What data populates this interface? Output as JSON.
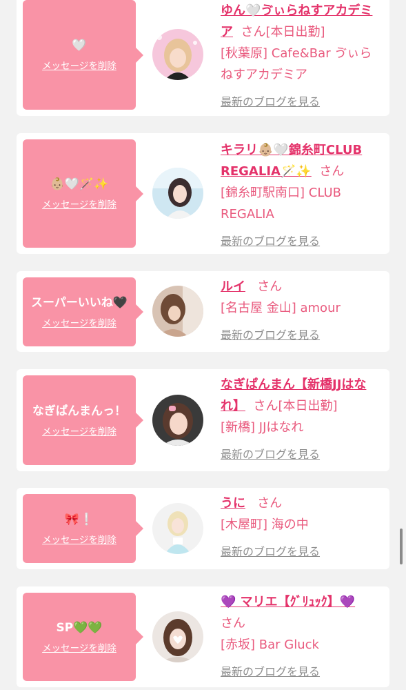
{
  "items": [
    {
      "message": "🤍",
      "delete_label": "メッセージを削除",
      "name": "ゆん🤍ゔぃらねすアカデミア",
      "honorific": "さん",
      "status": "[本日出勤]",
      "shop": "[秋葉原] Cafe&Bar ゔぃらねすアカデミア",
      "blog_link": "最新のブログを見る"
    },
    {
      "message": "👶🏼🤍🪄✨",
      "delete_label": "メッセージを削除",
      "name": "キラリ👶🏼🤍錦糸町CLUB REGALIA🪄✨",
      "honorific": "さん",
      "status": "",
      "shop": "[錦糸町駅南口] CLUB REGALIA",
      "blog_link": "最新のブログを見る"
    },
    {
      "message": "スーパーいいね🖤",
      "delete_label": "メッセージを削除",
      "name": "ルイ",
      "honorific": "さん",
      "status": "",
      "shop": "[名古屋 金山] amour",
      "blog_link": "最新のブログを見る"
    },
    {
      "message": "なぎぱんまんっ！",
      "delete_label": "メッセージを削除",
      "name": "なぎぱんまん【新橋JJはなれ】",
      "honorific": "さん",
      "status": "[本日出勤]",
      "shop": "[新橋] JJはなれ",
      "blog_link": "最新のブログを見る"
    },
    {
      "message": "🎀❕",
      "delete_label": "メッセージを削除",
      "name": "うに",
      "honorific": "さん",
      "status": "",
      "shop": "[木屋町] 海の中",
      "blog_link": "最新のブログを見る"
    },
    {
      "message": "SP💚💚",
      "delete_label": "メッセージを削除",
      "name": "💜 マリエ【ｸﾞﾘｭｯｸ】💜",
      "honorific": "さん",
      "status": "",
      "shop": "[赤坂] Bar Gluck",
      "blog_link": "最新のブログを見る"
    }
  ],
  "colors": {
    "accent": "#f993a6",
    "name": "#e4326a",
    "shop": "#e95a7e",
    "blog": "#8e8e8e",
    "background": "#f2f2f2"
  }
}
